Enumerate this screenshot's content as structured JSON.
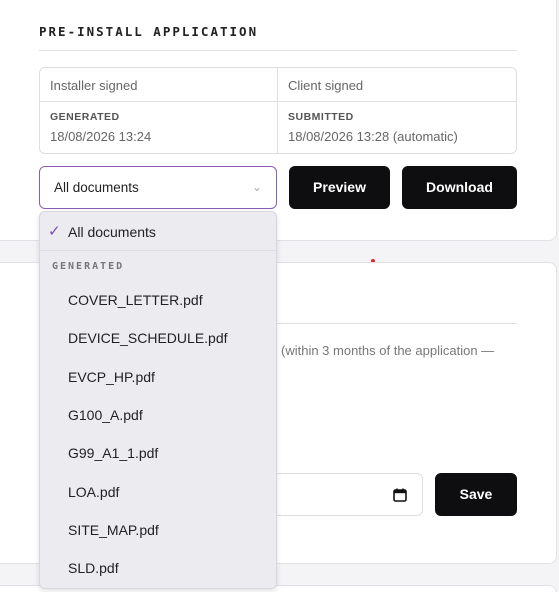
{
  "section": {
    "title": "PRE-INSTALL APPLICATION"
  },
  "signatures": {
    "installer": {
      "header": "Installer signed",
      "label": "GENERATED",
      "value": "18/08/2026 13:24"
    },
    "client": {
      "header": "Client signed",
      "label": "SUBMITTED",
      "value": "18/08/2026 13:28 (automatic)"
    }
  },
  "documents_select": {
    "value": "All documents"
  },
  "buttons": {
    "preview": "Preview",
    "download": "Download",
    "save": "Save"
  },
  "background_text": {
    "hint": "(within 3 months of the application —"
  },
  "dropdown": {
    "selected": "All documents",
    "group_label": "GENERATED",
    "items": [
      "COVER_LETTER.pdf",
      "DEVICE_SCHEDULE.pdf",
      "EVCP_HP.pdf",
      "G100_A.pdf",
      "G99_A1_1.pdf",
      "LOA.pdf",
      "SITE_MAP.pdf",
      "SLD.pdf"
    ]
  },
  "colors": {
    "accent": "#8a5db3",
    "button_bg": "#0e0e10",
    "alert_dot": "#e0262c"
  }
}
